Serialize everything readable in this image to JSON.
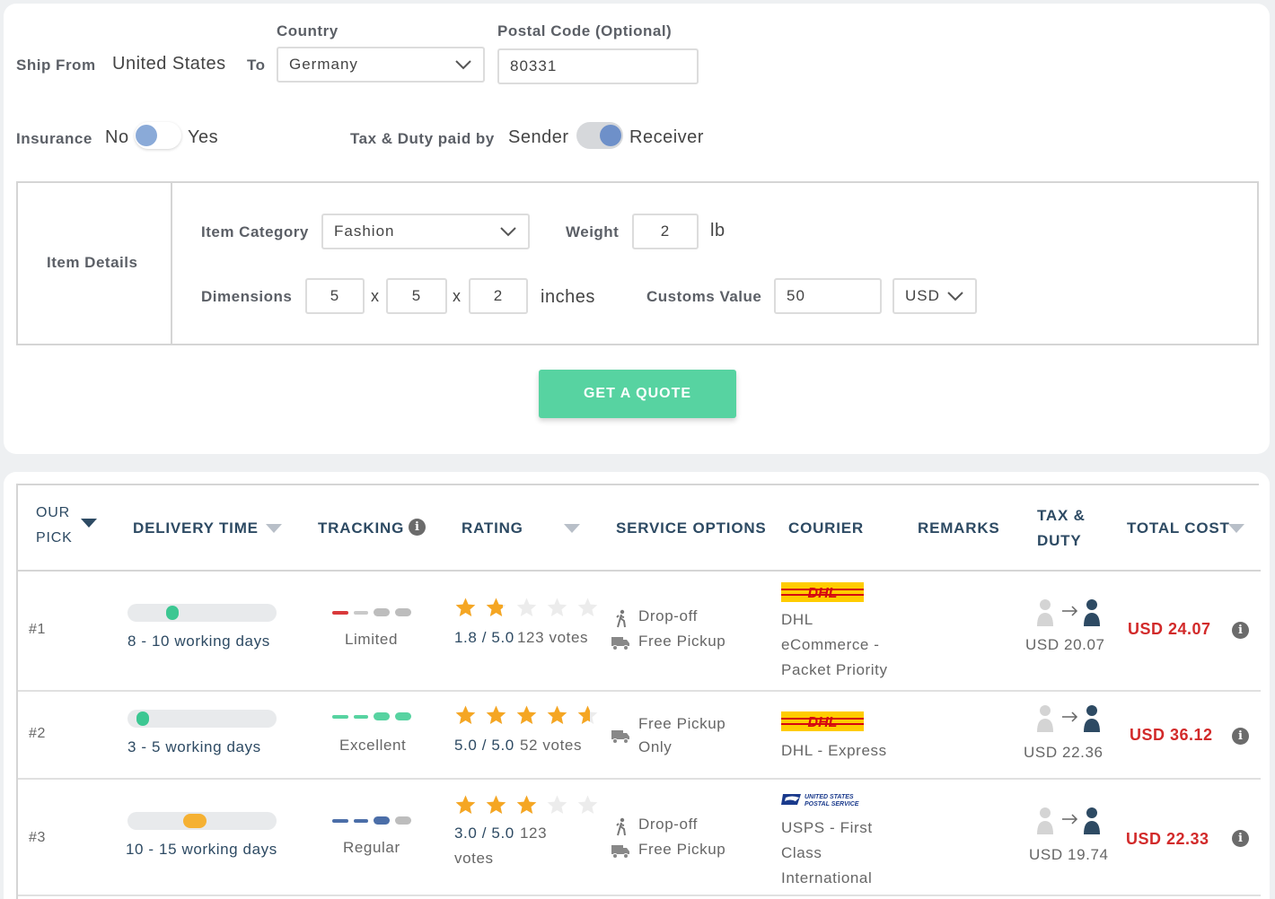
{
  "form": {
    "ship_from_label": "Ship From",
    "ship_from_value": "United States",
    "to_label": "To",
    "country_label": "Country",
    "country_value": "Germany",
    "postal_label": "Postal Code (Optional)",
    "postal_value": "80331",
    "insurance_label": "Insurance",
    "insurance_no": "No",
    "insurance_yes": "Yes",
    "tax_label": "Tax & Duty paid by",
    "tax_sender": "Sender",
    "tax_receiver": "Receiver",
    "item_details_label": "Item Details",
    "item_category_label": "Item Category",
    "item_category_value": "Fashion",
    "weight_label": "Weight",
    "weight_value": "2",
    "weight_unit": "lb",
    "dimensions_label": "Dimensions",
    "dim_l": "5",
    "dim_w": "5",
    "dim_h": "2",
    "dim_x": "x",
    "dim_unit": "inches",
    "customs_label": "Customs Value",
    "customs_value": "50",
    "currency_value": "USD",
    "quote_button": "GET A QUOTE"
  },
  "table": {
    "headers": {
      "our_pick_1": "OUR",
      "our_pick_2": "PICK",
      "delivery_time": "DELIVERY TIME",
      "tracking": "TRACKING",
      "rating": "RATING",
      "service_options": "SERVICE OPTIONS",
      "courier": "COURIER",
      "remarks": "REMARKS",
      "tax_1": "TAX &",
      "tax_2": "DUTY",
      "total_cost": "TOTAL COST"
    },
    "rows": [
      {
        "rank": "#1",
        "delivery": "8 - 10 working days",
        "delivery_level": 0.3,
        "delivery_color": "#3cc792",
        "tracking": "Limited",
        "tracking_colors": [
          "#d9393b",
          "#c9c9c9",
          "#bdbdbd",
          "#bdbdbd"
        ],
        "rating": "1.8",
        "rating_max": "/ 5.0",
        "votes": "123 votes",
        "stars": 1.8,
        "service_1": "Drop-off",
        "service_2": "Free Pickup",
        "courier_logo": "DHL",
        "courier_1": "DHL",
        "courier_2": "eCommerce -",
        "courier_3": "Packet Priority",
        "tax": "USD 20.07",
        "total": "USD 24.07"
      },
      {
        "rank": "#2",
        "delivery": "3 - 5 working days",
        "delivery_level": 0.1,
        "delivery_color": "#3cc792",
        "tracking": "Excellent",
        "tracking_colors": [
          "#57d3a1",
          "#57d3a1",
          "#57d3a1",
          "#57d3a1"
        ],
        "rating": "5.0",
        "rating_max": "/ 5.0",
        "votes": "52 votes",
        "stars": 4.6,
        "service_1": "Free Pickup",
        "service_2": "Only",
        "courier_logo": "DHL",
        "courier_1": "DHL - Express",
        "tax": "USD 22.36",
        "total": "USD 36.12"
      },
      {
        "rank": "#3",
        "delivery": "10 - 15 working days",
        "delivery_level": 0.45,
        "delivery_color": "#f5b133",
        "tracking": "Regular",
        "tracking_colors": [
          "#4b6ea8",
          "#4b6ea8",
          "#4b6ea8",
          "#bdbdbd"
        ],
        "rating": "3.0",
        "rating_max": "/ 5.0",
        "votes_1": "123",
        "votes_2": "votes",
        "stars": 3.0,
        "service_1": "Drop-off",
        "service_2": "Free Pickup",
        "courier_logo": "USPS",
        "usps_logo_1": "UNITED STATES",
        "usps_logo_2": "POSTAL SERVICE",
        "courier_1": "USPS - First",
        "courier_2": "Class",
        "courier_3": "International",
        "tax": "USD 19.74",
        "total": "USD 22.33"
      }
    ]
  },
  "icons": {
    "info": "info-circle-icon",
    "chevron": "chevron-down-icon",
    "star": "star-icon",
    "dropoff": "walking-person-icon",
    "pickup": "truck-icon",
    "transfer": "sender-to-receiver-icon"
  },
  "colors": {
    "accent_green": "#57d3a1",
    "price_red": "#d22a2a",
    "header_blue": "#2d4a63",
    "star_orange": "#f5a623"
  }
}
